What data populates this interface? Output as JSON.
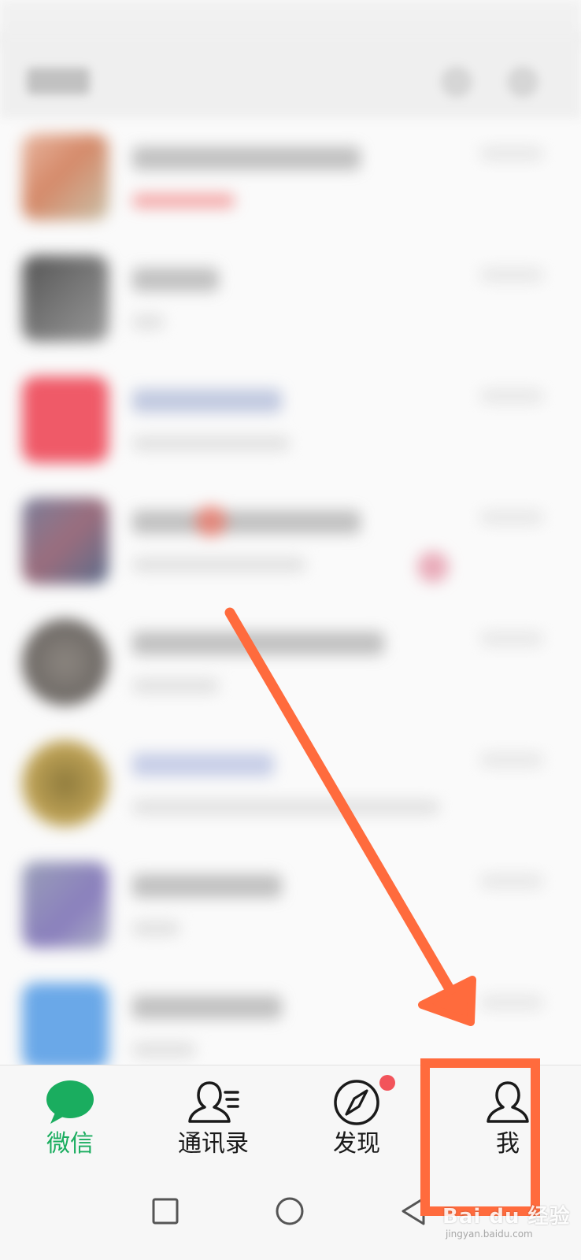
{
  "tabbar": {
    "tabs": [
      {
        "label": "微信",
        "icon": "chat-bubble-icon",
        "active": true
      },
      {
        "label": "通讯录",
        "icon": "contacts-icon",
        "active": false
      },
      {
        "label": "发现",
        "icon": "compass-icon",
        "active": false,
        "badge": true
      },
      {
        "label": "我",
        "icon": "person-icon",
        "active": false
      }
    ]
  },
  "navbar": {
    "buttons": [
      "recent-apps-icon",
      "home-icon",
      "back-icon"
    ]
  },
  "annotation": {
    "color": "#ff6b3d",
    "highlighted_tab": "我"
  },
  "watermark": {
    "main": "Bai du 经验",
    "sub": "jingyan.baidu.com"
  },
  "colors": {
    "accent": "#1aad5f",
    "badge": "#f2545b",
    "text": "#1a1a1a"
  }
}
